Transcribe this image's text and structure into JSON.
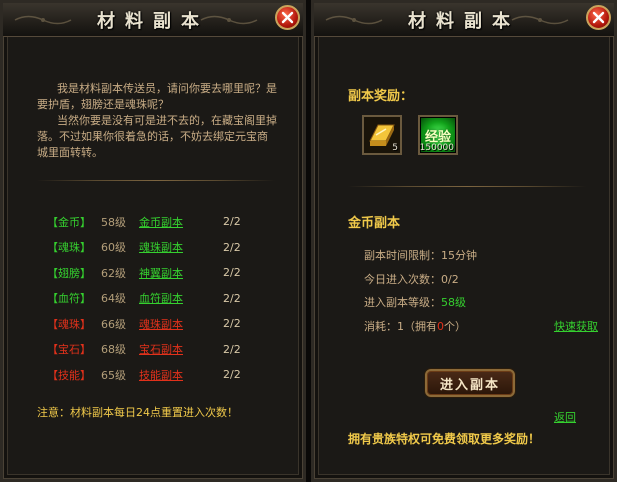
{
  "left_panel": {
    "title": "材料副本",
    "intro": [
      "我是材料副本传送员，请问你要去哪里呢？是要护盾，翅膀还是魂珠呢？",
      "当然你要是没有可是进不去的，在藏宝阁里掉落。不过如果你很着急的话，不妨去绑定元宝商城里面转转。"
    ],
    "dungeons": [
      {
        "tag": "【金币】",
        "level": "58级",
        "name": "金币副本",
        "count": "2/2",
        "status": "available"
      },
      {
        "tag": "【魂珠】",
        "level": "60级",
        "name": "魂珠副本",
        "count": "2/2",
        "status": "available"
      },
      {
        "tag": "【翅膀】",
        "level": "62级",
        "name": "神翼副本",
        "count": "2/2",
        "status": "available"
      },
      {
        "tag": "【血符】",
        "level": "64级",
        "name": "血符副本",
        "count": "2/2",
        "status": "available"
      },
      {
        "tag": "【魂珠】",
        "level": "66级",
        "name": "魂珠副本",
        "count": "2/2",
        "status": "locked"
      },
      {
        "tag": "【宝石】",
        "level": "68级",
        "name": "宝石副本",
        "count": "2/2",
        "status": "locked"
      },
      {
        "tag": "【技能】",
        "level": "65级",
        "name": "技能副本",
        "count": "2/2",
        "status": "locked"
      }
    ],
    "notice": "注意：材料副本每日24点重置进入次数！"
  },
  "right_panel": {
    "title": "材料副本",
    "reward_title": "副本奖励：",
    "rewards": [
      {
        "icon": "gold-ingot-icon",
        "quantity": "5"
      },
      {
        "icon": "experience-icon",
        "label": "经验",
        "quantity": "150000"
      }
    ],
    "section_title": "金币副本",
    "info": {
      "time_limit_label": "副本时间限制：",
      "time_limit_value": "15分钟",
      "entries_label": "今日进入次数：",
      "entries_value": "0/2",
      "level_label": "进入副本等级：",
      "level_value": "58级",
      "cost_prefix": "消耗：1（拥有",
      "cost_owned": "0",
      "cost_suffix": "个）"
    },
    "quick_buy": "快速获取",
    "enter_button": "进入副本",
    "back_link": "返回",
    "bottom_text": "拥有贵族特权可免费领取更多奖励！"
  },
  "colors": {
    "accent_gold": "#f0c94a",
    "available_green": "#35d02f",
    "locked_red": "#e2311b"
  }
}
